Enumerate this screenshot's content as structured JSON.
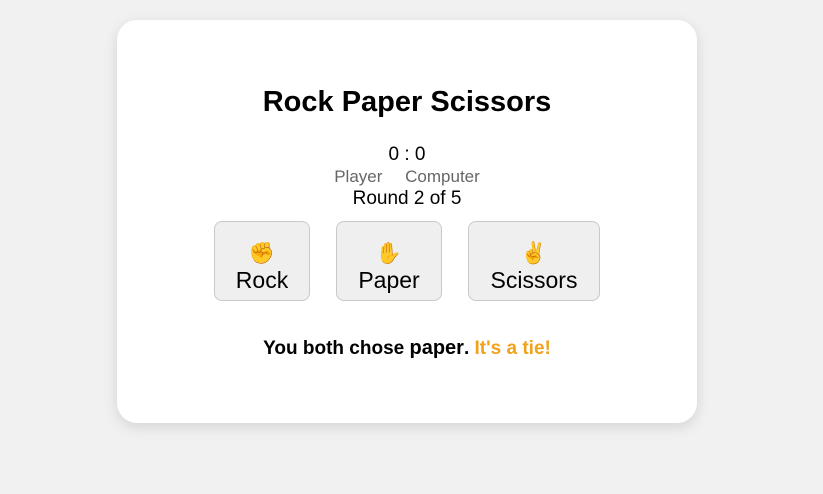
{
  "game": {
    "title": "Rock Paper Scissors",
    "score": "0 : 0",
    "player_label": "Player",
    "computer_label": "Computer",
    "round_text": "Round 2 of 5",
    "choices": [
      {
        "emoji": "✊",
        "label": "Rock",
        "icon": "fist-emoji-icon"
      },
      {
        "emoji": "✋",
        "label": "Paper",
        "icon": "raised-hand-emoji-icon"
      },
      {
        "emoji": "✌️",
        "label": "Scissors",
        "icon": "victory-hand-emoji-icon"
      }
    ],
    "result": {
      "prefix": "You both chose",
      "choice": "paper",
      "period": ".",
      "outcome": "It's a tie!"
    },
    "colors": {
      "background": "#f1f1f1",
      "card": "#ffffff",
      "tie": "#f0a21b",
      "label_gray": "#666666"
    }
  }
}
